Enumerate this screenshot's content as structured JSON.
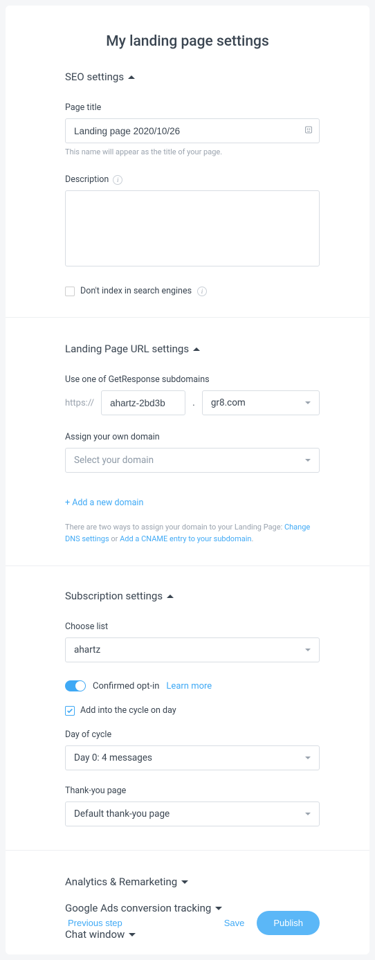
{
  "title": "My landing page settings",
  "seo": {
    "header": "SEO settings",
    "page_title_label": "Page title",
    "page_title_value": "Landing page 2020/10/26",
    "page_title_hint": "This name will appear as the title of your page.",
    "description_label": "Description",
    "description_value": "",
    "noindex_label": "Don't index in search engines"
  },
  "url": {
    "header": "Landing Page URL settings",
    "subdomain_label": "Use one of GetResponse subdomains",
    "protocol": "https://",
    "subdomain_value": "ahartz-2bd3b",
    "domain_value": "gr8.com",
    "own_domain_label": "Assign your own domain",
    "own_domain_placeholder": "Select your domain",
    "add_domain_link": "+ Add a new domain",
    "hint_pre": "There are two ways to assign your domain to your Landing Page: ",
    "hint_link1": "Change DNS settings",
    "hint_mid": " or ",
    "hint_link2": "Add a CNAME entry to your subdomain",
    "hint_post": "."
  },
  "subscription": {
    "header": "Subscription settings",
    "choose_list_label": "Choose list",
    "list_value": "ahartz",
    "confirmed_optin_label": "Confirmed opt-in",
    "learn_more": "Learn more",
    "add_cycle_label": "Add into the cycle on day",
    "day_of_cycle_label": "Day of cycle",
    "day_of_cycle_value": "Day 0: 4 messages",
    "thankyou_label": "Thank-you page",
    "thankyou_value": "Default thank-you page"
  },
  "collapsed": {
    "analytics": "Analytics & Remarketing",
    "google_ads": "Google Ads conversion tracking",
    "chat": "Chat window"
  },
  "footer": {
    "prev": "Previous step",
    "save": "Save",
    "publish": "Publish"
  }
}
